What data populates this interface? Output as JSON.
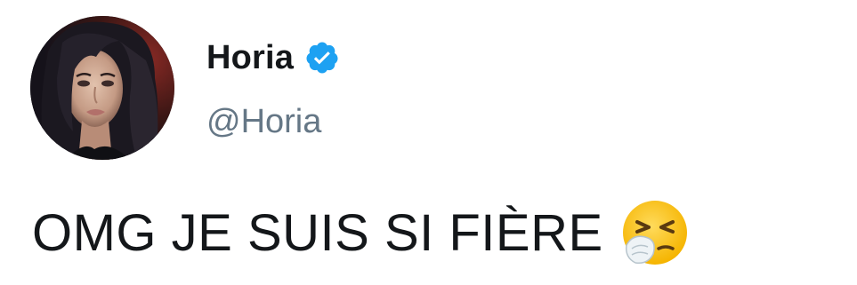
{
  "tweet": {
    "author": {
      "display_name": "Horia",
      "handle": "@Horia",
      "verified": true,
      "verified_icon": "verified-badge-icon",
      "avatar": "profile-photo"
    },
    "text": "OMG JE SUIS SI FIÈRE",
    "emoji": "sneezing-face-emoji"
  },
  "colors": {
    "text_primary": "#14171a",
    "text_secondary": "#657786",
    "verified_blue": "#1da1f2",
    "background": "#ffffff"
  }
}
